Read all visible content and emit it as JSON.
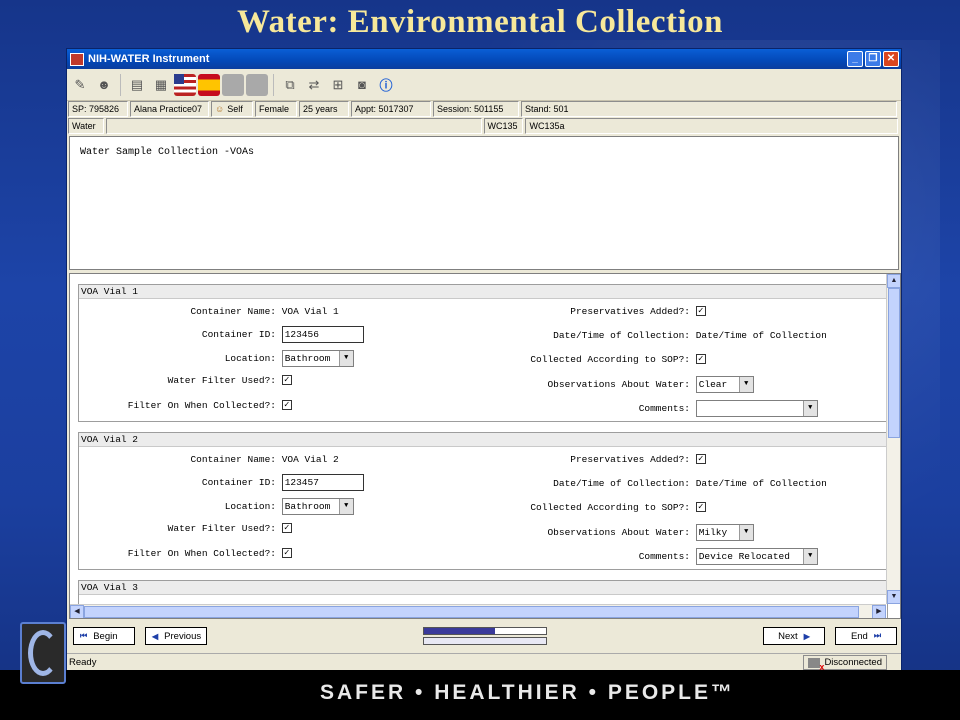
{
  "slide": {
    "title": "Water: Environmental Collection",
    "tagline": "SAFER • HEALTHIER • PEOPLE™"
  },
  "window": {
    "title": "NIH-WATER Instrument"
  },
  "toolbar": {
    "icons": [
      "pencils-icon",
      "person-icon",
      "notes-icon",
      "notebook-icon",
      "us-flag-icon",
      "spain-flag-icon",
      "gray-square-icon",
      "gray-square-icon",
      "copy-icon",
      "link-icon",
      "shuffle-icon",
      "camera-icon",
      "info-icon"
    ]
  },
  "info_bar": {
    "sp": "SP: 795826",
    "name": "Alana Practice07",
    "relation": "Self",
    "sex": "Female",
    "age": "25 years",
    "appt": "Appt: 5017307",
    "session": "Session: 501155",
    "stand": "Stand: 501"
  },
  "section_bar": {
    "section": "Water",
    "code1": "WC135",
    "code2": "WC135a"
  },
  "question": {
    "text": "Water Sample Collection -VOAs"
  },
  "vials": [
    {
      "header": "VOA Vial 1",
      "container_name_label": "Container Name:",
      "container_name": "VOA Vial 1",
      "container_id_label": "Container ID:",
      "container_id": "123456",
      "location_label": "Location:",
      "location": "Bathroom",
      "filter_used_label": "Water Filter Used?:",
      "filter_on_label": "Filter On When Collected?:",
      "preservatives_label": "Preservatives Added?:",
      "datetime_label": "Date/Time of Collection:",
      "datetime_value": "Date/Time of Collection",
      "sop_label": "Collected According to SOP?:",
      "observations_label": "Observations About Water:",
      "observations": "Clear",
      "comments_label": "Comments:",
      "comments": ""
    },
    {
      "header": "VOA Vial 2",
      "container_name_label": "Container Name:",
      "container_name": "VOA Vial 2",
      "container_id_label": "Container ID:",
      "container_id": "123457",
      "location_label": "Location:",
      "location": "Bathroom",
      "filter_used_label": "Water Filter Used?:",
      "filter_on_label": "Filter On When Collected?:",
      "preservatives_label": "Preservatives Added?:",
      "datetime_label": "Date/Time of Collection:",
      "datetime_value": "Date/Time of Collection",
      "sop_label": "Collected According to SOP?:",
      "observations_label": "Observations About Water:",
      "observations": "Milky",
      "comments_label": "Comments:",
      "comments": "Device Relocated"
    },
    {
      "header": "VOA Vial 3"
    }
  ],
  "nav": {
    "begin": "Begin",
    "previous": "Previous",
    "next": "Next",
    "end": "End",
    "progress": 0.58
  },
  "status": {
    "left": "Ready",
    "right": "Disconnected"
  }
}
